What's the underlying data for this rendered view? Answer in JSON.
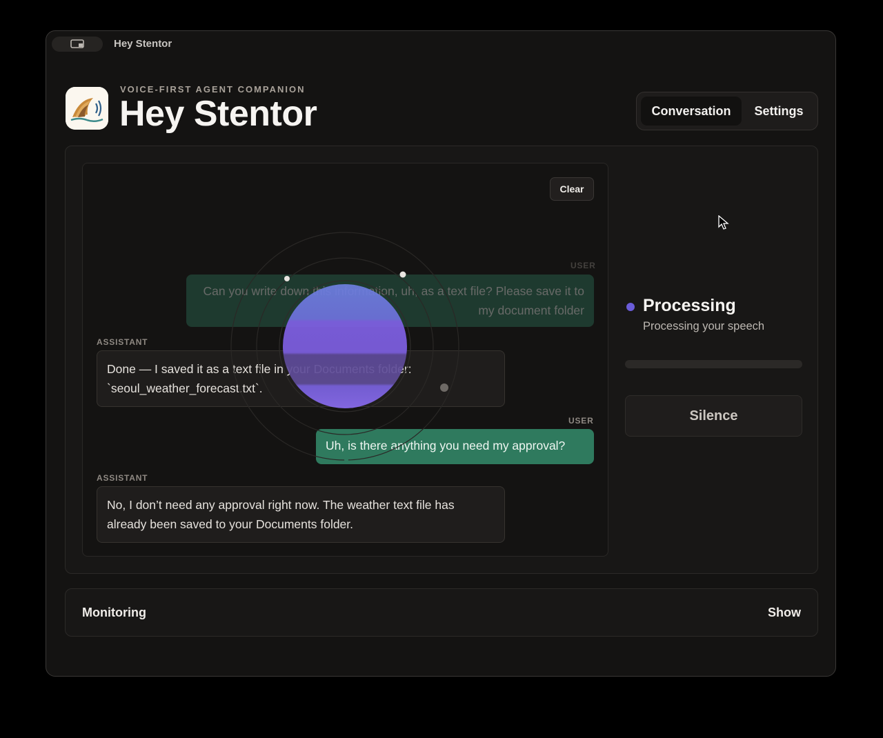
{
  "window": {
    "title": "Hey Stentor"
  },
  "header": {
    "eyebrow": "VOICE-FIRST AGENT COMPANION",
    "title": "Hey Stentor",
    "app_icon": "stentor-app-icon"
  },
  "tabs": [
    {
      "label": "Conversation",
      "active": true
    },
    {
      "label": "Settings",
      "active": false
    }
  ],
  "chat": {
    "clear_label": "Clear",
    "messages": [
      {
        "role": "USER",
        "text": "Can you write down this information, uh, as a text file? Please save it to my document folder",
        "faded": true
      },
      {
        "role": "ASSISTANT",
        "text": "Done — I saved it as a text file in your Documents folder: `seoul_weather_forecast.txt`."
      },
      {
        "role": "USER",
        "text": "Uh, is there anything you need my approval?"
      },
      {
        "role": "ASSISTANT",
        "text": "No, I don’t need any approval right now. The weather text file has already been saved to your Documents folder."
      }
    ]
  },
  "status": {
    "title": "Processing",
    "subtitle": "Processing your speech",
    "dot_color": "#6a5cd8",
    "progress": 0
  },
  "silence_label": "Silence",
  "monitoring": {
    "label": "Monitoring",
    "toggle_label": "Show"
  },
  "colors": {
    "user_bubble": "#2f7a5e",
    "orb": "#7b68ee",
    "background": "#141312"
  }
}
